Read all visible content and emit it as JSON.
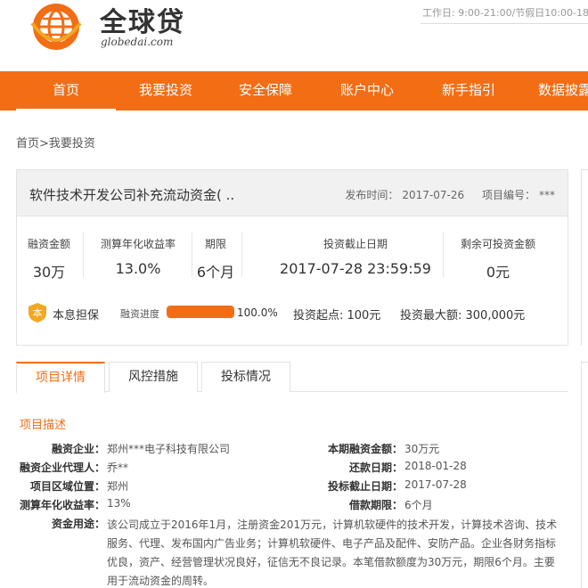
{
  "header": {
    "logo_title": "全球贷",
    "logo_url": "globedai.com",
    "worktime": "工作日: 9:00-21:00/节假日10:00-18"
  },
  "nav": {
    "items": [
      "首页",
      "我要投资",
      "安全保障",
      "账户中心",
      "新手指引",
      "数据披露"
    ]
  },
  "breadcrumb": "首页>我要投资",
  "project": {
    "title": "软件技术开发公司补充流动资金( ..",
    "publish_label": "发布时间：",
    "publish_date": "2017-07-26",
    "code_label": "项目编号：",
    "code_value": "***",
    "stats": [
      {
        "label": "融资金额",
        "value": "30万"
      },
      {
        "label": "测算年化收益率",
        "value": "13.0%"
      },
      {
        "label": "期限",
        "value": "6个月"
      },
      {
        "label": "投资截止日期",
        "value": "2017-07-28 23:59:59"
      },
      {
        "label": "剩余可投资金额",
        "value": "0元"
      }
    ],
    "guarantee_icon_text": "本",
    "guarantee": "本息担保",
    "progress_label": "融资进度",
    "progress": 100.0,
    "progress_text": "100.0%",
    "min_invest": "投资起点: 100元",
    "max_invest": "投资最大额: 300,000元"
  },
  "tabs": [
    "项目详情",
    "风控措施",
    "投标情况"
  ],
  "details": {
    "section_title": "项目描述",
    "left": [
      {
        "key": "融资企业：",
        "value": "郑州***电子科技有限公司"
      },
      {
        "key": "融资企业代理人：",
        "value": "乔**"
      },
      {
        "key": "项目区域位置：",
        "value": "郑州"
      },
      {
        "key": "测算年化收益率：",
        "value": "13%"
      }
    ],
    "right": [
      {
        "key": "本期融资金额：",
        "value": "30万元"
      },
      {
        "key": "还款日期：",
        "value": "2018-01-28"
      },
      {
        "key": "投标截止日期：",
        "value": "2017-07-28"
      },
      {
        "key": "借款期限：",
        "value": "6个月"
      }
    ],
    "usage_key": "资金用途：",
    "usage_value": "该公司成立于2016年1月，注册资金201万元，计算机软硬件的技术开发，计算技术咨询、技术服务、代理、发布国内广告业务；计算机软硬件、电子产品及配件、安防产品。企业各财务指标优良，资产、经营管理状况良好，征信无不良记录。本笔借款额度为30万元，期限6个月。主要用于流动资金的周转。"
  },
  "colors": {
    "accent": "#f26d14"
  }
}
